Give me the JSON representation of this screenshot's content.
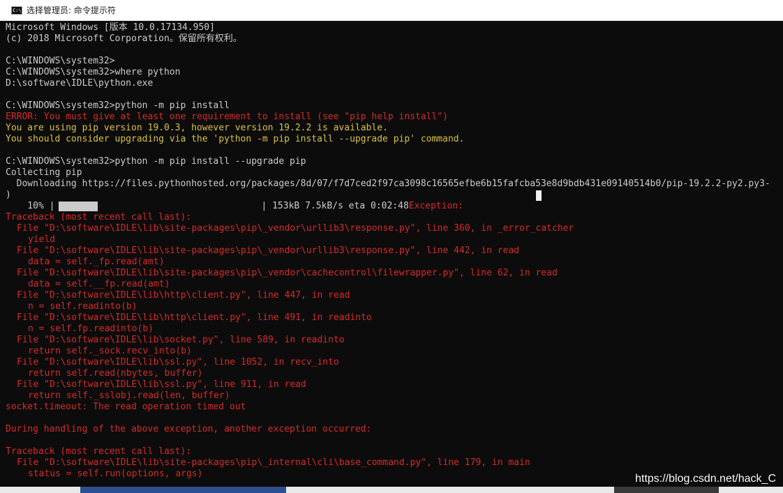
{
  "window": {
    "title": "选择管理员: 命令提示符",
    "icon": "cmd-icon",
    "icon_label": "C:\\"
  },
  "console_lines": [
    {
      "text": "Microsoft Windows [版本 10.0.17134.950]",
      "style": "normal"
    },
    {
      "text": "(c) 2018 Microsoft Corporation。保留所有权利。",
      "style": "normal"
    },
    {
      "text": "",
      "style": "normal"
    },
    {
      "text": "C:\\WINDOWS\\system32>",
      "style": "normal"
    },
    {
      "text": "C:\\WINDOWS\\system32>where python",
      "style": "normal"
    },
    {
      "text": "D:\\software\\IDLE\\python.exe",
      "style": "normal"
    },
    {
      "text": "",
      "style": "normal"
    },
    {
      "text": "C:\\WINDOWS\\system32>python -m pip install",
      "style": "normal"
    },
    {
      "text": "ERROR: You must give at least one requirement to install (see \"pip help install\")",
      "style": "err"
    },
    {
      "text": "You are using pip version 19.0.3, however version 19.2.2 is available.",
      "style": "warn"
    },
    {
      "text": "You should consider upgrading via the 'python -m pip install --upgrade pip' command.",
      "style": "warn"
    },
    {
      "text": "",
      "style": "normal"
    },
    {
      "text": "C:\\WINDOWS\\system32>python -m pip install --upgrade pip",
      "style": "normal"
    },
    {
      "text": "Collecting pip",
      "style": "normal"
    },
    {
      "text": "  Downloading https://files.pythonhosted.org/packages/8d/07/f7d7ced2f97ca3098c16565efbe6b15fafcba53e8d9bdb431e09140514b0/pip-19.2.2-py2.py3-",
      "style": "normal"
    },
    {
      "text": ")",
      "style": "normal"
    }
  ],
  "progress": {
    "percent_label": "    10% |",
    "fraction": 0.19,
    "stats": "| 153kB 7.5kB/s eta 0:02:48",
    "exception_label": "Exception:"
  },
  "traceback_lines": [
    {
      "text": "Traceback (most recent call last):",
      "indent": 0
    },
    {
      "text": "File \"D:\\software\\IDLE\\lib\\site-packages\\pip\\_vendor\\urllib3\\response.py\", line 360, in _error_catcher",
      "indent": 1
    },
    {
      "text": "yield",
      "indent": 2
    },
    {
      "text": "File \"D:\\software\\IDLE\\lib\\site-packages\\pip\\_vendor\\urllib3\\response.py\", line 442, in read",
      "indent": 1
    },
    {
      "text": "data = self._fp.read(amt)",
      "indent": 2
    },
    {
      "text": "File \"D:\\software\\IDLE\\lib\\site-packages\\pip\\_vendor\\cachecontrol\\filewrapper.py\", line 62, in read",
      "indent": 1
    },
    {
      "text": "data = self.__fp.read(amt)",
      "indent": 2
    },
    {
      "text": "File \"D:\\software\\IDLE\\lib\\http\\client.py\", line 447, in read",
      "indent": 1
    },
    {
      "text": "n = self.readinto(b)",
      "indent": 2
    },
    {
      "text": "File \"D:\\software\\IDLE\\lib\\http\\client.py\", line 491, in readinto",
      "indent": 1
    },
    {
      "text": "n = self.fp.readinto(b)",
      "indent": 2
    },
    {
      "text": "File \"D:\\software\\IDLE\\lib\\socket.py\", line 589, in readinto",
      "indent": 1
    },
    {
      "text": "return self._sock.recv_into(b)",
      "indent": 2
    },
    {
      "text": "File \"D:\\software\\IDLE\\lib\\ssl.py\", line 1052, in recv_into",
      "indent": 1
    },
    {
      "text": "return self.read(nbytes, buffer)",
      "indent": 2
    },
    {
      "text": "File \"D:\\software\\IDLE\\lib\\ssl.py\", line 911, in read",
      "indent": 1
    },
    {
      "text": "return self._sslobj.read(len, buffer)",
      "indent": 2
    },
    {
      "text": "socket.timeout: The read operation timed out",
      "indent": 0
    },
    {
      "text": "",
      "indent": 0
    },
    {
      "text": "During handling of the above exception, another exception occurred:",
      "indent": 0
    },
    {
      "text": "",
      "indent": 0
    },
    {
      "text": "Traceback (most recent call last):",
      "indent": 0
    },
    {
      "text": "File \"D:\\software\\IDLE\\lib\\site-packages\\pip\\_internal\\cli\\base_command.py\", line 179, in main",
      "indent": 1
    },
    {
      "text": "status = self.run(options, args)",
      "indent": 2
    }
  ],
  "watermark": "https://blog.csdn.net/hack_C",
  "colors": {
    "console_bg": "#0c0c0c",
    "text": "#cccccc",
    "error": "#d42b2b",
    "warning": "#d9c146"
  }
}
